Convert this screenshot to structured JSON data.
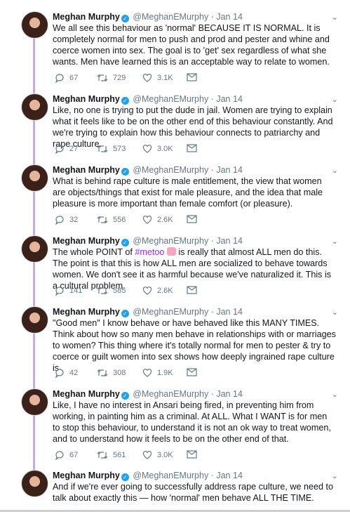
{
  "tweets": [
    {
      "name": "Meghan Murphy",
      "handle": "@MeghanEMurphy",
      "date": "Jan 14",
      "text": "We all see this behaviour as 'normal' BECAUSE IT IS NORMAL. It is completely normal for men to push and prod and pester and whine and coerce women into sex. The goal is to 'get' sex regardless of what she wants. Men have learned this is an acceptable way to relate to women.",
      "replies": "67",
      "retweets": "729",
      "likes": "3.1K"
    },
    {
      "name": "Meghan Murphy",
      "handle": "@MeghanEMurphy",
      "date": "Jan 14",
      "text": "Like, no one is trying to put the dude in jail. Women are trying to explain what it feels like to be on the other end of this behaviour constantly. And we're trying to explain how this behaviour connects to patriarchy and rape culture.",
      "replies": "27",
      "retweets": "573",
      "likes": "3.0K"
    },
    {
      "name": "Meghan Murphy",
      "handle": "@MeghanEMurphy",
      "date": "Jan 14",
      "text": "What is behind rape culture is male entitlement, the view that women are objects/things that exist for male pleasure, and the idea that male pleasure is more important than female comfort (or pleasure).",
      "replies": "32",
      "retweets": "556",
      "likes": "2.6K"
    },
    {
      "name": "Meghan Murphy",
      "handle": "@MeghanEMurphy",
      "date": "Jan 14",
      "text_before": "The whole POINT of ",
      "hashtag": "#metoo",
      "text_after": " is really that almost ALL men do this. The point is that this is how ALL men are socialized to behave towards women. We don't see it as harmful because we've naturalized it. This is a cultural problem.",
      "replies": "141",
      "retweets": "585",
      "likes": "2.6K"
    },
    {
      "name": "Meghan Murphy",
      "handle": "@MeghanEMurphy",
      "date": "Jan 14",
      "text": "\"Good men\" I know behave or have behaved like this MANY TIMES. Think about how so many men behave in relationships with or marriages to women? This thing where it's totally normal for men to pester & try to coerce or guilt women into sex shows how deeply ingrained rape culture is",
      "replies": "42",
      "retweets": "308",
      "likes": "1.9K"
    },
    {
      "name": "Meghan Murphy",
      "handle": "@MeghanEMurphy",
      "date": "Jan 14",
      "text": "Like, I have no interest in Ansari being fired, in preventing him from working, in painting him as a criminal. At ALL. What I WANT is for men to stop this behaviour, to understand it is not an ok way to treat women, and to understand how it feels to be on the other end of that.",
      "replies": "67",
      "retweets": "561",
      "likes": "3.0K"
    },
    {
      "name": "Meghan Murphy",
      "handle": "@MeghanEMurphy",
      "date": "Jan 14",
      "text": "And if we're ever going to successfully address rape culture, we need to talk about exactly this — how 'normal' men behave ALL THE TIME."
    }
  ],
  "colors": {
    "thread": "#c9a8ef",
    "hashtag": "#8b33e6",
    "muted": "#657786",
    "verified": "#1da1f2"
  },
  "icons": [
    "reply-icon",
    "retweet-icon",
    "like-icon",
    "dm-icon",
    "chevron-down-icon",
    "verified-icon"
  ]
}
